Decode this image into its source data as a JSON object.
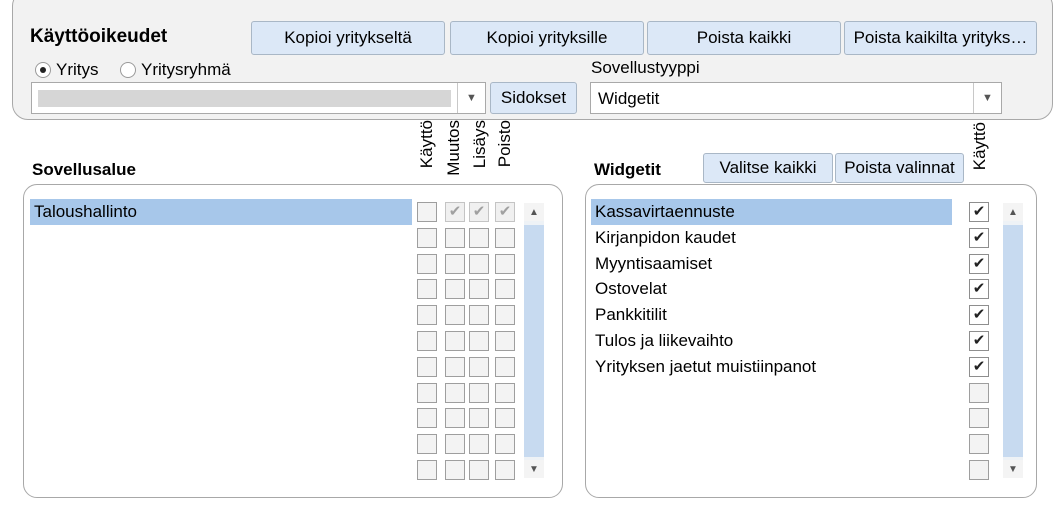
{
  "permissions": {
    "title": "Käyttöoikeudet",
    "buttons": {
      "copy_from_company": "Kopioi yritykseltä",
      "copy_to_companies": "Kopioi yrityksille",
      "remove_all": "Poista kaikki",
      "remove_all_from_companies": "Poista kaikilta yrityks…"
    },
    "radio_company": "Yritys",
    "radio_company_group": "Yritysryhmä",
    "selected_radio": "Yritys",
    "company_select_value": "",
    "bindings_button": "Sidokset",
    "app_type_label": "Sovellustyyppi",
    "app_type_value": "Widgetit"
  },
  "areas": {
    "heading": "Sovellusalue",
    "columns": [
      "Käyttö",
      "Muutos",
      "Lisäys",
      "Poisto"
    ],
    "rows": [
      {
        "label": "Taloushallinto",
        "selected": true,
        "checks": [
          false,
          true,
          true,
          true
        ],
        "disabled": [
          false,
          true,
          true,
          true
        ]
      },
      {
        "label": "",
        "selected": false,
        "checks": [
          false,
          false,
          false,
          false
        ],
        "disabled": [
          false,
          false,
          false,
          false
        ]
      },
      {
        "label": "",
        "selected": false,
        "checks": [
          false,
          false,
          false,
          false
        ],
        "disabled": [
          false,
          false,
          false,
          false
        ]
      },
      {
        "label": "",
        "selected": false,
        "checks": [
          false,
          false,
          false,
          false
        ],
        "disabled": [
          false,
          false,
          false,
          false
        ]
      },
      {
        "label": "",
        "selected": false,
        "checks": [
          false,
          false,
          false,
          false
        ],
        "disabled": [
          false,
          false,
          false,
          false
        ]
      },
      {
        "label": "",
        "selected": false,
        "checks": [
          false,
          false,
          false,
          false
        ],
        "disabled": [
          false,
          false,
          false,
          false
        ]
      },
      {
        "label": "",
        "selected": false,
        "checks": [
          false,
          false,
          false,
          false
        ],
        "disabled": [
          false,
          false,
          false,
          false
        ]
      },
      {
        "label": "",
        "selected": false,
        "checks": [
          false,
          false,
          false,
          false
        ],
        "disabled": [
          false,
          false,
          false,
          false
        ]
      },
      {
        "label": "",
        "selected": false,
        "checks": [
          false,
          false,
          false,
          false
        ],
        "disabled": [
          false,
          false,
          false,
          false
        ]
      },
      {
        "label": "",
        "selected": false,
        "checks": [
          false,
          false,
          false,
          false
        ],
        "disabled": [
          false,
          false,
          false,
          false
        ]
      },
      {
        "label": "",
        "selected": false,
        "checks": [
          false,
          false,
          false,
          false
        ],
        "disabled": [
          false,
          false,
          false,
          false
        ]
      }
    ]
  },
  "widgets": {
    "heading": "Widgetit",
    "select_all": "Valitse kaikki",
    "clear_selection": "Poista valinnat",
    "column": "Käyttö",
    "rows": [
      {
        "label": "Kassavirtaennuste",
        "selected": true,
        "checked": true
      },
      {
        "label": "Kirjanpidon kaudet",
        "selected": false,
        "checked": true
      },
      {
        "label": "Myyntisaamiset",
        "selected": false,
        "checked": true
      },
      {
        "label": "Ostovelat",
        "selected": false,
        "checked": true
      },
      {
        "label": "Pankkitilit",
        "selected": false,
        "checked": true
      },
      {
        "label": "Tulos ja liikevaihto",
        "selected": false,
        "checked": true
      },
      {
        "label": "Yrityksen jaetut muistiinpanot",
        "selected": false,
        "checked": true
      },
      {
        "label": "",
        "selected": false,
        "checked": false
      },
      {
        "label": "",
        "selected": false,
        "checked": false
      },
      {
        "label": "",
        "selected": false,
        "checked": false
      },
      {
        "label": "",
        "selected": false,
        "checked": false
      }
    ]
  },
  "icons": {
    "scroll_up": "scroll-up-arrow-icon",
    "scroll_down": "scroll-down-arrow-icon",
    "dropdown": "chevron-down-icon"
  },
  "colors": {
    "selection": "#a7c7ea",
    "button": "#dce8f7"
  }
}
